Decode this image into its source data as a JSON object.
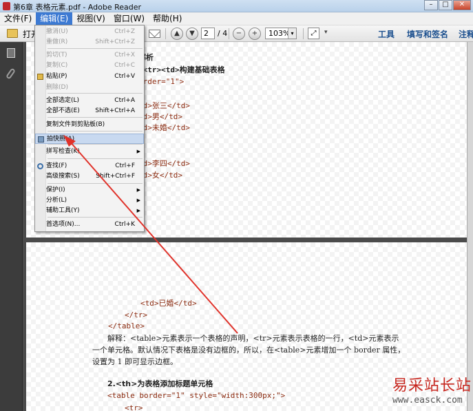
{
  "window": {
    "title": "第6章 表格元素.pdf - Adobe Reader",
    "btn_min": "–",
    "btn_max": "□",
    "btn_close": "✕"
  },
  "menubar": {
    "items": [
      "文件(F)",
      "编辑(E)",
      "视图(V)",
      "窗口(W)",
      "帮助(H)"
    ],
    "active_index": 1
  },
  "toolbar": {
    "open_label": "打开",
    "page_current": "2",
    "page_total": "/ 4",
    "zoom": "103%",
    "tools_label": "工具",
    "sign_label": "填写和签名",
    "comment_label": "注释",
    "up_glyph": "▲",
    "down_glyph": "▼",
    "minus_glyph": "−",
    "plus_glyph": "+",
    "dropdown_glyph": "▾",
    "fit_glyph": "⤢",
    "more_glyph": "▾"
  },
  "edit_menu": {
    "items": [
      {
        "label": "撤消(U)",
        "shortcut": "Ctrl+Z",
        "disabled": true
      },
      {
        "label": "重做(R)",
        "shortcut": "Shift+Ctrl+Z",
        "disabled": true
      },
      {
        "label": "剪切(T)",
        "shortcut": "Ctrl+X",
        "disabled": true
      },
      {
        "label": "复制(C)",
        "shortcut": "Ctrl+C",
        "disabled": true
      },
      {
        "label": "粘贴(P)",
        "shortcut": "Ctrl+V",
        "disabled": false
      },
      {
        "label": "删除(D)",
        "shortcut": "",
        "disabled": true
      },
      {
        "label": "全部选定(L)",
        "shortcut": "Ctrl+A",
        "disabled": false
      },
      {
        "label": "全部不选(E)",
        "shortcut": "Shift+Ctrl+A",
        "disabled": false
      },
      {
        "label": "复制文件到剪贴板(B)",
        "shortcut": "",
        "disabled": false
      },
      {
        "label": "拍快照(A)",
        "shortcut": "",
        "disabled": false,
        "highlighted": true
      },
      {
        "label": "拼写检查(K)",
        "shortcut": "",
        "submenu": true
      },
      {
        "label": "查找(F)",
        "shortcut": "Ctrl+F",
        "disabled": false
      },
      {
        "label": "高级搜索(S)",
        "shortcut": "Shift+Ctrl+F",
        "disabled": false
      },
      {
        "label": "保护(I)",
        "shortcut": "",
        "submenu": true
      },
      {
        "label": "分析(L)",
        "shortcut": "",
        "submenu": true
      },
      {
        "label": "辅助工具(Y)",
        "shortcut": "",
        "submenu": true
      },
      {
        "label": "首选项(N)...",
        "shortcut": "Ctrl+K",
        "disabled": false
      }
    ],
    "submenu_glyph": "▶"
  },
  "page1": {
    "lines": [
      "解析",
      ">&lt;tr>&lt;td>构建基础表格",
      "order=\"1\">",
      "td>张三&lt;/td>",
      "td>男&lt;/td>",
      "td>未婚&lt;/td>",
      "td>李四&lt;/td>",
      "td>女&lt;/td>"
    ]
  },
  "page2": {
    "code": [
      "<td>已婚</td>",
      "</tr>",
      "</table>"
    ],
    "para": [
      "解释：<table>元素表示一个表格的声明，<tr>元素表示表格的一行，<td>元素表示",
      "一个单元格。默认情况下表格是没有边框的，所以，在<table>元素增加一个 border 属性，",
      "设置为 1 即可显示边框。"
    ],
    "heading": "2.<th>为表格添加标题单元格",
    "code2": [
      "<table border=\"1\" style=\"width:300px;\">",
      "<tr>"
    ]
  },
  "watermark": {
    "cn": "易采站长站",
    "en": "www.easck.com"
  },
  "colors": {
    "menu_active": "#3d7ad3",
    "link": "#1b4f8e",
    "code": "#8b2b10",
    "arrow": "#e0322a",
    "watermark": "#c7261e"
  }
}
